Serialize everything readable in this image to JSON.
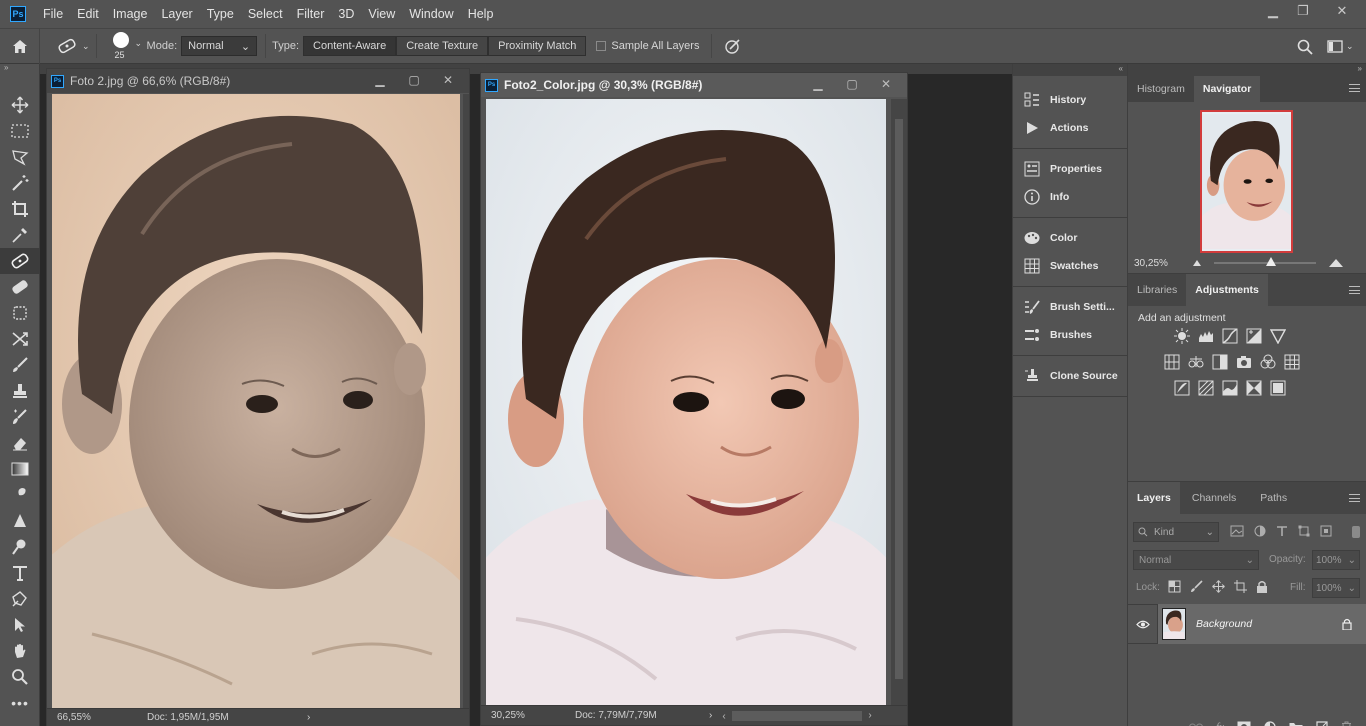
{
  "menu": [
    "File",
    "Edit",
    "Image",
    "Layer",
    "Type",
    "Select",
    "Filter",
    "3D",
    "View",
    "Window",
    "Help"
  ],
  "app_logo": "Ps",
  "options": {
    "brush_size": "25",
    "mode_label": "Mode:",
    "mode_value": "Normal",
    "type_label": "Type:",
    "type_buttons": [
      "Content-Aware",
      "Create Texture",
      "Proximity Match"
    ],
    "sample_label": "Sample All Layers"
  },
  "doc1": {
    "title": "Foto 2.jpg @ 66,6% (RGB/8#)",
    "zoom": "66,55%",
    "info": "Doc: 1,95M/1,95M"
  },
  "doc2": {
    "title": "Foto2_Color.jpg @ 30,3% (RGB/8#)",
    "zoom": "30,25%",
    "info": "Doc: 7,79M/7,79M"
  },
  "column_panels": [
    "History",
    "Actions",
    "Properties",
    "Info",
    "Color",
    "Swatches",
    "Brush Setti...",
    "Brushes",
    "Clone Source"
  ],
  "navigator": {
    "tabs": [
      "Histogram",
      "Navigator"
    ],
    "zoom": "30,25%"
  },
  "adjustments": {
    "tabs": [
      "Libraries",
      "Adjustments"
    ],
    "title": "Add an adjustment"
  },
  "layers": {
    "tabs": [
      "Layers",
      "Channels",
      "Paths"
    ],
    "kind": "Kind",
    "blend": "Normal",
    "opacity_label": "Opacity:",
    "opacity_value": "100%",
    "lock_label": "Lock:",
    "fill_label": "Fill:",
    "fill_value": "100%",
    "layer_name": "Background"
  },
  "colors": {
    "accent": "#31a8ff",
    "panel": "#535353",
    "canvas_bg": "#282828"
  }
}
